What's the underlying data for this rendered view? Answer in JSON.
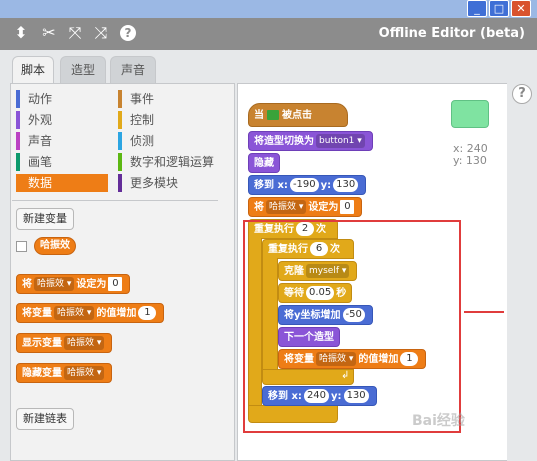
{
  "toolbar": {
    "title": "Offline Editor (beta)"
  },
  "tabs": [
    {
      "label": "脚本"
    },
    {
      "label": "造型"
    },
    {
      "label": "声音"
    }
  ],
  "palette": {
    "categories_left": [
      {
        "label": "动作",
        "color": "#4a6cd4"
      },
      {
        "label": "外观",
        "color": "#8a55d7"
      },
      {
        "label": "声音",
        "color": "#bb42c3"
      },
      {
        "label": "画笔",
        "color": "#0e9a6c"
      },
      {
        "label": "数据",
        "color": "#ee7d16"
      }
    ],
    "categories_right": [
      {
        "label": "事件",
        "color": "#c88330"
      },
      {
        "label": "控制",
        "color": "#e1a91a"
      },
      {
        "label": "侦测",
        "color": "#2ca5e2"
      },
      {
        "label": "数字和逻辑运算",
        "color": "#5cb712"
      },
      {
        "label": "更多模块",
        "color": "#632d99"
      }
    ],
    "new_variable_button": "新建变量",
    "variable_reporter": "哈振效",
    "block_set": {
      "prefix": "将",
      "var": "哈振效",
      "mid": "设定为",
      "value": "0"
    },
    "block_change": {
      "prefix": "将变量",
      "var": "哈振效",
      "mid": "的值增加",
      "value": "1"
    },
    "block_show": {
      "prefix": "显示变量",
      "var": "哈振效"
    },
    "block_hide": {
      "prefix": "隐藏变量",
      "var": "哈振效"
    },
    "new_list_button": "新建链表"
  },
  "stage_info": {
    "x_label": "x:",
    "x_value": "240",
    "y_label": "y:",
    "y_value": "130",
    "help": "?"
  },
  "script": {
    "hat": {
      "prefix": "当",
      "suffix": "被点击"
    },
    "switch_costume": {
      "label": "将造型切换为",
      "value": "button1"
    },
    "hide": {
      "label": "隐藏"
    },
    "goto1": {
      "label": "移到 x:",
      "x": "-190",
      "y_label": "y:",
      "y": "130"
    },
    "set_var": {
      "prefix": "将",
      "var": "哈振效",
      "mid": "设定为",
      "value": "0"
    },
    "repeat_outer": {
      "label": "重复执行",
      "value": "2",
      "suffix": "次"
    },
    "repeat_inner": {
      "label": "重复执行",
      "value": "6",
      "suffix": "次"
    },
    "clone": {
      "label": "克隆",
      "value": "myself"
    },
    "wait": {
      "label": "等待",
      "value": "0.05",
      "suffix": "秒"
    },
    "change_y": {
      "label": "将y坐标增加",
      "value": "-50"
    },
    "next_costume": {
      "label": "下一个造型"
    },
    "change_var": {
      "prefix": "将变量",
      "var": "哈振效",
      "mid": "的值增加",
      "value": "1"
    },
    "goto2": {
      "label": "移到 x:",
      "x": "240",
      "y_label": "y:",
      "y": "130"
    }
  },
  "watermark": "Bai经验"
}
